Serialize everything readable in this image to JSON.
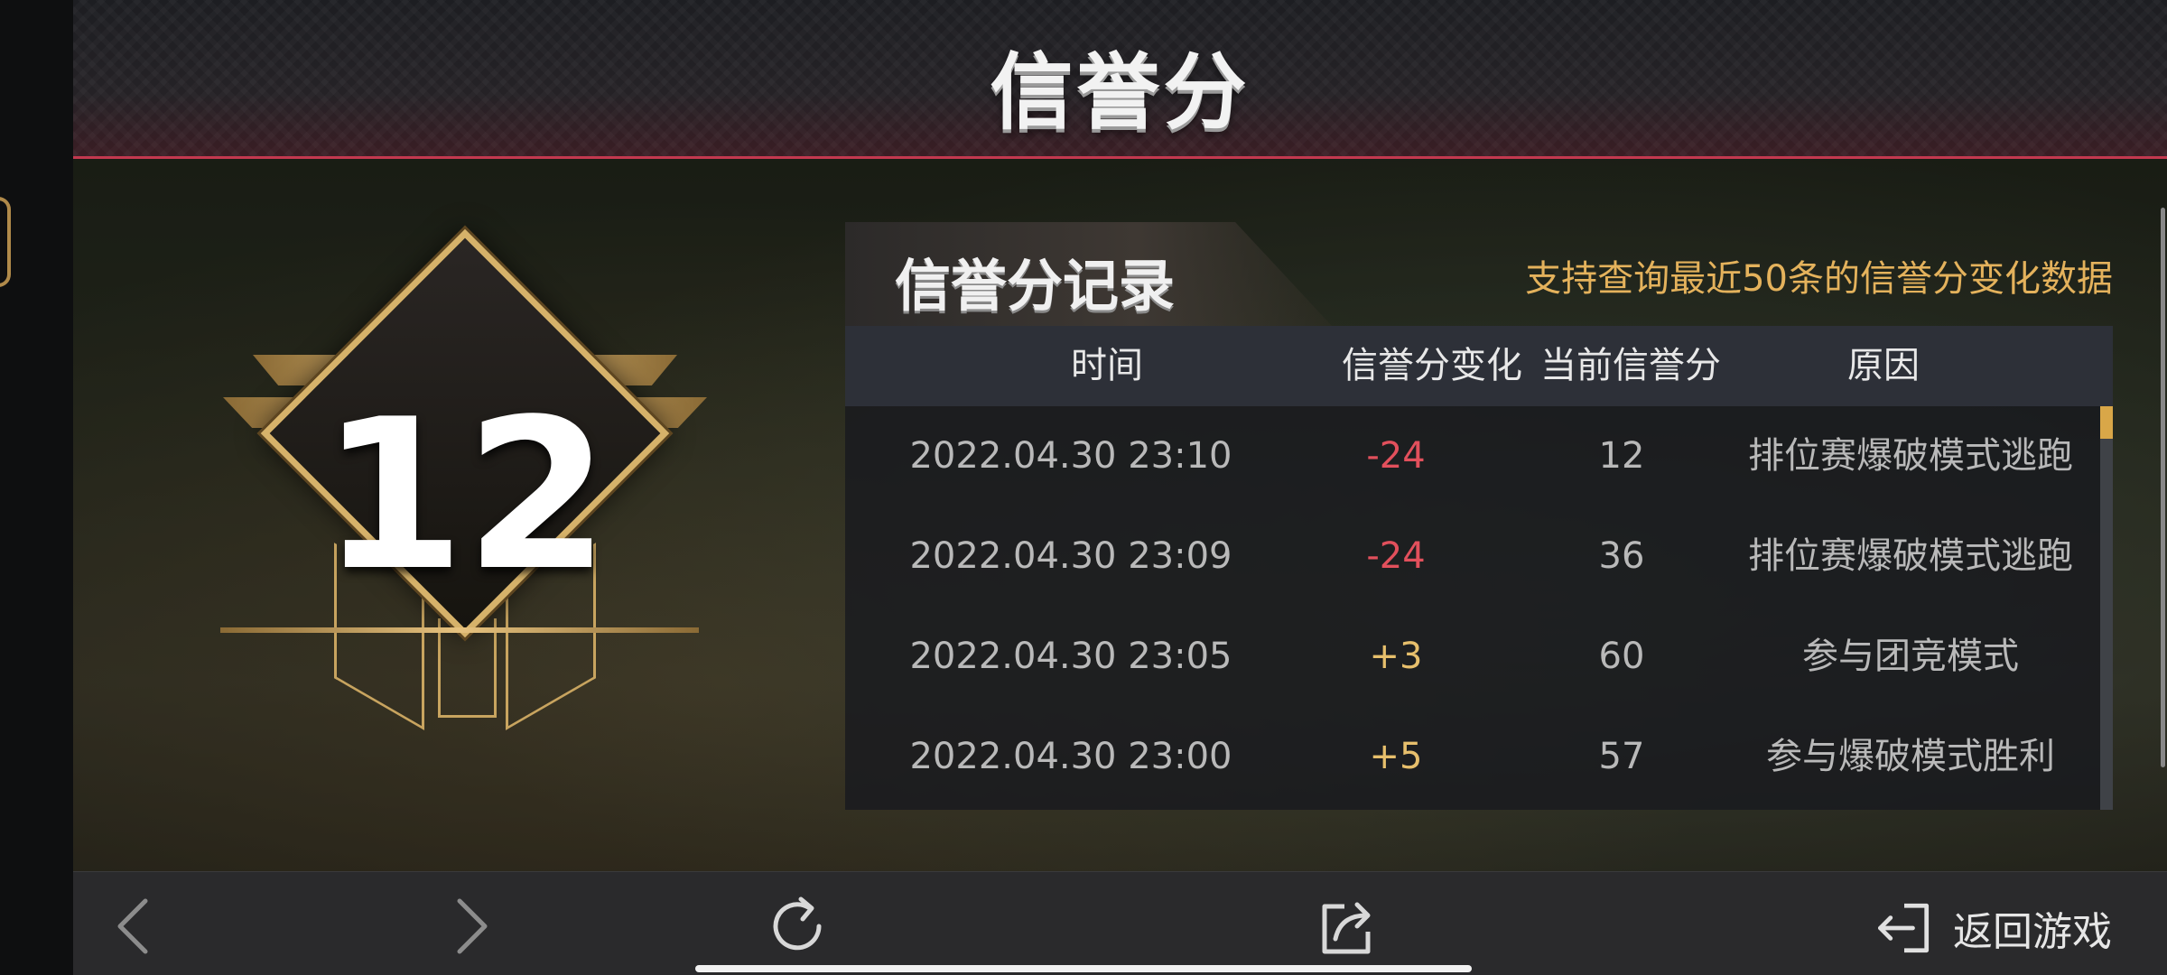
{
  "header": {
    "title": "信誉分"
  },
  "badge": {
    "score": "12"
  },
  "records": {
    "heading": "信誉分记录",
    "note": "支持查询最近50条的信誉分变化数据",
    "columns": [
      "时间",
      "信誉分变化",
      "当前信誉分",
      "原因"
    ],
    "rows": [
      {
        "time": "2022.04.30 23:10",
        "change": "-24",
        "current": "12",
        "reason": "排位赛爆破模式逃跑"
      },
      {
        "time": "2022.04.30 23:09",
        "change": "-24",
        "current": "36",
        "reason": "排位赛爆破模式逃跑"
      },
      {
        "time": "2022.04.30 23:05",
        "change": "+3",
        "current": "60",
        "reason": "参与团竞模式"
      },
      {
        "time": "2022.04.30 23:00",
        "change": "+5",
        "current": "57",
        "reason": "参与爆破模式胜利"
      }
    ]
  },
  "toolbar": {
    "back_icon": "chevron-left-icon",
    "forward_icon": "chevron-right-icon",
    "refresh_icon": "refresh-icon",
    "share_icon": "share-icon",
    "return_icon": "exit-icon",
    "return_label": "返回游戏"
  },
  "colors": {
    "accent_red": "#c3384f",
    "gold": "#e4b25c",
    "negative": "#e2505c",
    "positive": "#e7bf6c"
  }
}
